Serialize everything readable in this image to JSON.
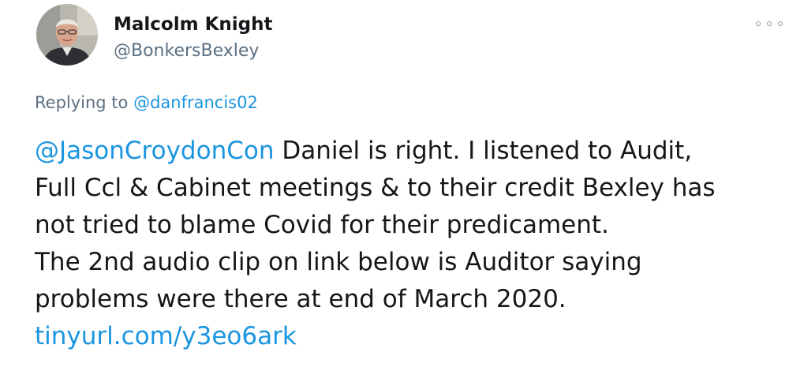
{
  "author": {
    "display_name": "Malcolm Knight",
    "handle": "@BonkersBexley",
    "avatar_icon": "user-avatar-photo"
  },
  "menu": {
    "icon": "more-options-icon"
  },
  "reply": {
    "prefix": "Replying to ",
    "mention": "@danfrancis02"
  },
  "tweet": {
    "mention": "@JasonCroydonCon",
    "line1_rest": " Daniel is right. I listened to Audit,",
    "line2": "Full Ccl & Cabinet meetings & to their credit Bexley has",
    "line3": "not tried to blame Covid for their predicament.",
    "line4": "The 2nd audio clip on link below is Auditor saying",
    "line5": "problems were there at end of March 2020.",
    "link": "tinyurl.com/y3eo6ark"
  },
  "colors": {
    "accent": "#1b95e0",
    "text": "#14171a",
    "secondary": "#5b7083"
  }
}
